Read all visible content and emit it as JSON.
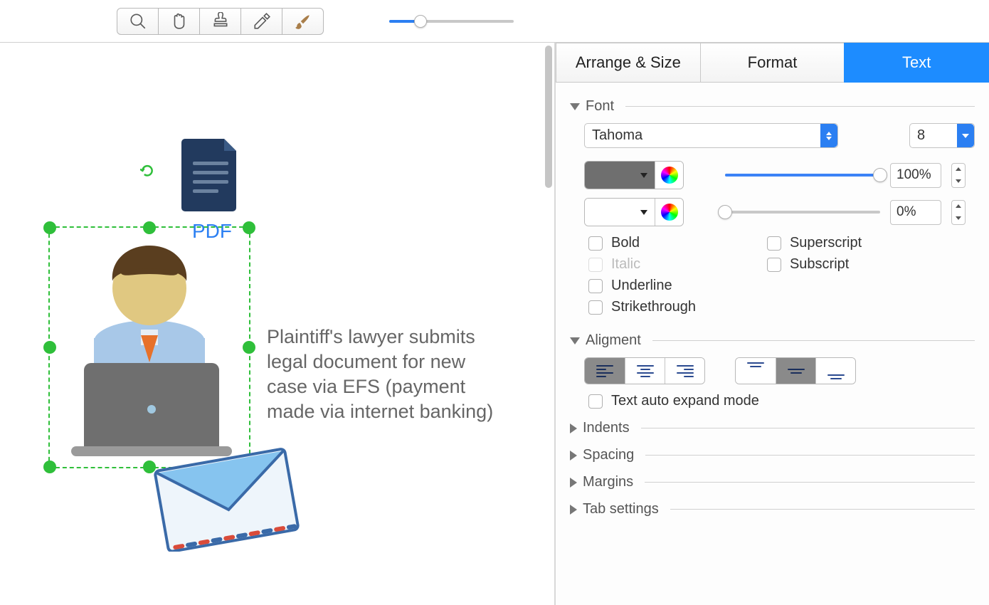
{
  "toolbar": {
    "tools": [
      "magnifier",
      "hand",
      "stamp",
      "eyedropper",
      "brush"
    ],
    "zoom": {
      "value_percent": 25
    }
  },
  "canvas": {
    "pdf_label": "PDF",
    "caption": "Plaintiff's lawyer submits legal document for new case via EFS (payment made via internet banking)"
  },
  "inspector": {
    "tabs": {
      "arrange": "Arrange & Size",
      "format": "Format",
      "text": "Text",
      "active": "text"
    },
    "font": {
      "title": "Font",
      "family": "Tahoma",
      "size": "8",
      "opacity1": "100%",
      "opacity2": "0%",
      "bold": "Bold",
      "italic": "Italic",
      "underline": "Underline",
      "strike": "Strikethrough",
      "superscript": "Superscript",
      "subscript": "Subscript"
    },
    "alignment": {
      "title": "Aligment",
      "auto_expand": "Text auto expand mode"
    },
    "indents": "Indents",
    "spacing": "Spacing",
    "margins": "Margins",
    "tabset": "Tab settings"
  }
}
